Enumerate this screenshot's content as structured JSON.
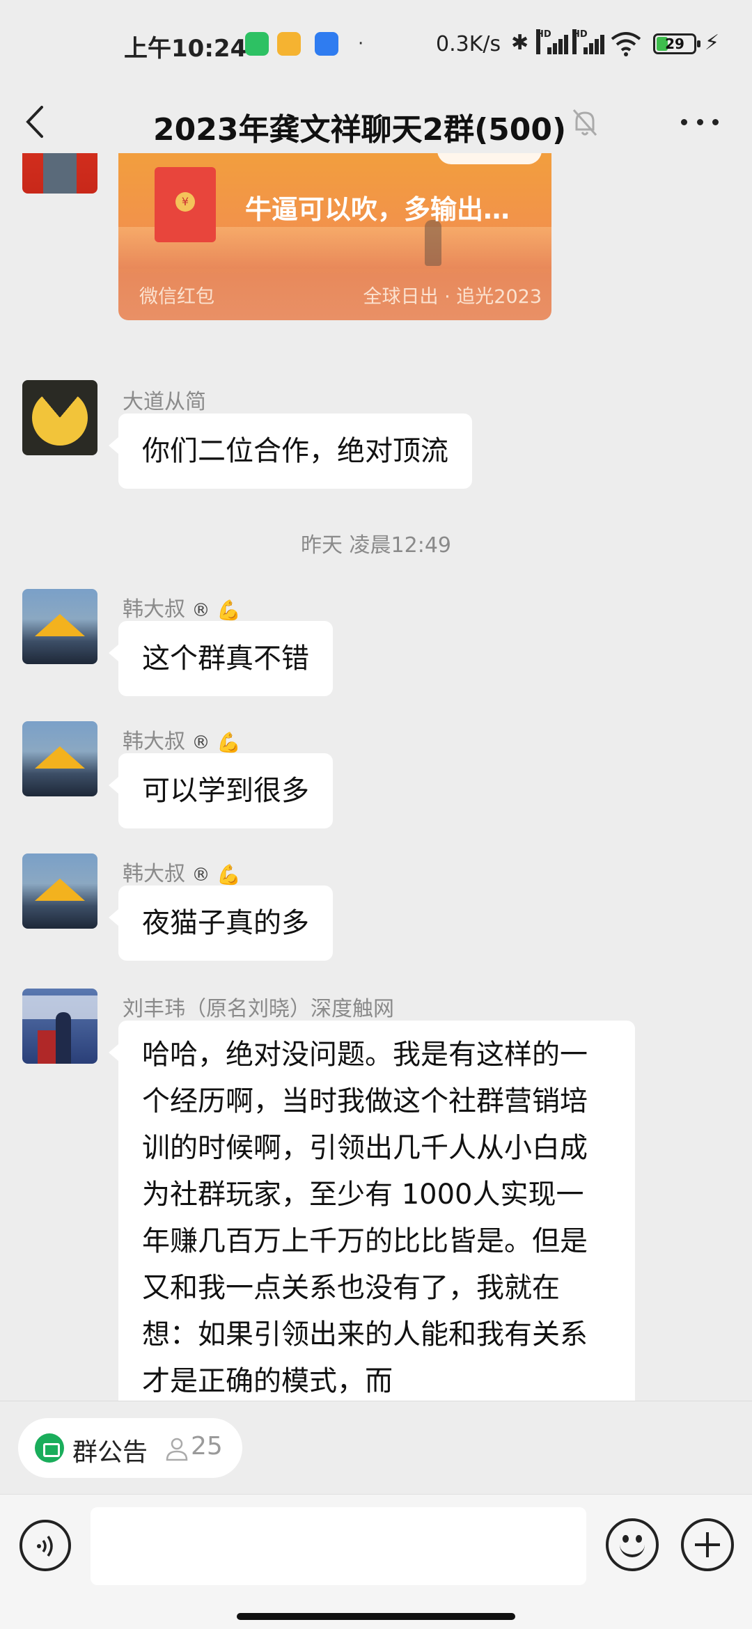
{
  "status_bar": {
    "time": "上午10:24",
    "app_icons": [
      "wechat-icon",
      "notes-icon",
      "radio-icon"
    ],
    "dot": "·",
    "net_speed": "0.3K/s",
    "signal_label": "HD",
    "battery_level": "29"
  },
  "nav": {
    "title": "2023年龚文祥聊天2群(500)"
  },
  "messages": [
    {
      "type": "red_packet",
      "title": "牛逼可以吹，多输出…",
      "label": "微信红包",
      "cover": "全球日出 · 追光2023"
    },
    {
      "type": "text",
      "sender": "大道从简",
      "text": "你们二位合作，绝对顶流"
    },
    {
      "type": "timestamp",
      "text": "昨天 凌晨12:49"
    },
    {
      "type": "text",
      "sender": "韩大叔",
      "sender_badge": "®",
      "text": "这个群真不错"
    },
    {
      "type": "text",
      "sender": "韩大叔",
      "sender_badge": "®",
      "text": "可以学到很多"
    },
    {
      "type": "text",
      "sender": "韩大叔",
      "sender_badge": "®",
      "text": "夜猫子真的多"
    },
    {
      "type": "text",
      "sender": "刘丰玮（原名刘晓）深度触网",
      "text": "哈哈，绝对没问题。我是有这样的一个经历啊，当时我做这个社群营销培训的时候啊，引领出几千人从小白成为社群玩家，至少有 1000人实现一年赚几百万上千万的比比皆是。但是又和我一点关系也没有了，我就在想：如果引领出来的人能和我有关系才是正确的模式，而"
    }
  ],
  "announcement": {
    "label": "群公告",
    "member_count": "25"
  },
  "input": {
    "value": ""
  },
  "colors": {
    "background": "#ededed",
    "bubble": "#ffffff",
    "accent_green": "#1aad5b",
    "red_packet": "#f2a03c"
  }
}
